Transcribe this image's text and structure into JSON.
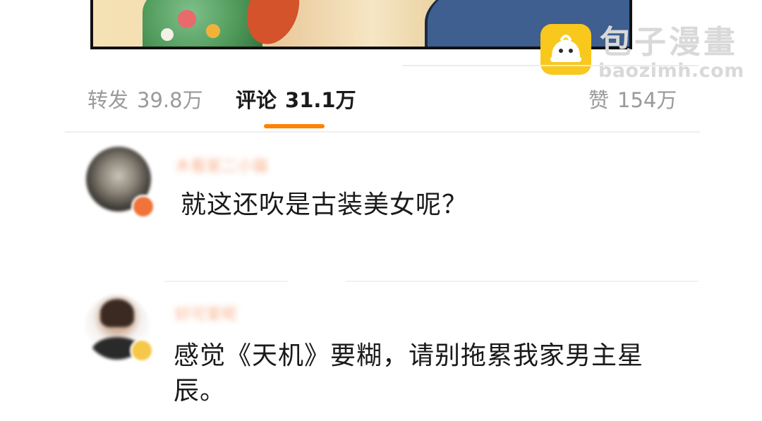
{
  "watermark": {
    "title": "包子漫畫",
    "url": "baozimh.com",
    "logo_icon": "baozi-bun-icon",
    "logo_color": "#f9c81c"
  },
  "tabs": {
    "repost": {
      "label": "转发",
      "count": "39.8万"
    },
    "comment": {
      "label": "评论",
      "count": "31.1万"
    },
    "like": {
      "label": "赞",
      "count": "154万"
    },
    "active_color": "#ff8200"
  },
  "comments": [
    {
      "username": "木看家二小猫",
      "text": "就这还吹是古装美女呢？",
      "badge_color": "#f0733a"
    },
    {
      "username": "好可爱呢",
      "text": "感觉《天机》要糊，请别拖累我家男主星辰。",
      "badge_color": "#f6c84a"
    }
  ]
}
